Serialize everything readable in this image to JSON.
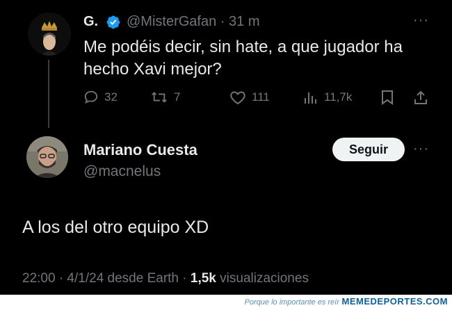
{
  "tweet": {
    "author_name": "G.",
    "author_handle": "@MisterGafan",
    "time_ago": "· 31 m",
    "more": "···",
    "text": "Me podéis decir, sin hate, a que jugador ha hecho Xavi mejor?",
    "actions": {
      "replies": "32",
      "retweets": "7",
      "likes": "111",
      "views": "11,7k"
    }
  },
  "reply": {
    "author_name": "Mariano Cuesta",
    "author_handle": "@macnelus",
    "follow_label": "Seguir",
    "more": "···",
    "text": "A los del otro equipo XD",
    "meta_time": "22:00 · 4/1/24 desde Earth · ",
    "meta_views_count": "1,5k",
    "meta_views_label": " visualizaciones"
  },
  "watermark": {
    "small": "Porque lo importante es reír",
    "big": "MEMEDEPORTES.COM"
  },
  "colors": {
    "background": "#000000",
    "text": "#e7e9ea",
    "secondary": "#71767b",
    "verified": "#1d9bf0",
    "follow_bg": "#eff3f4"
  },
  "icons": [
    "reply-icon",
    "retweet-icon",
    "like-icon",
    "views-icon",
    "bookmark-icon",
    "share-icon",
    "verified-icon"
  ]
}
